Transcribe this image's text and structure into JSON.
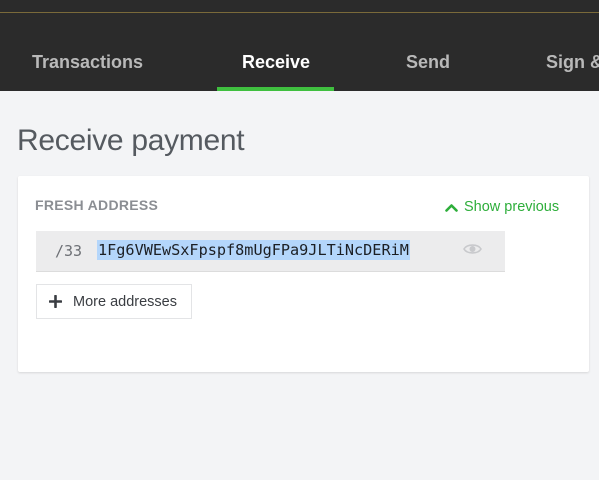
{
  "nav": {
    "tabs": [
      {
        "label": "Transactions",
        "active": false
      },
      {
        "label": "Receive",
        "active": true
      },
      {
        "label": "Send",
        "active": false
      },
      {
        "label": "Sign &",
        "active": false
      }
    ]
  },
  "page": {
    "title": "Receive payment"
  },
  "card": {
    "section_label": "FRESH ADDRESS",
    "show_previous_label": "Show previous",
    "address": {
      "index": "/33",
      "value": "1Fg6VWEwSxFpspf8mUgFPa9JLTiNcDERiM",
      "selected": true
    },
    "more_addresses_label": "More addresses"
  },
  "colors": {
    "accent": "#3fbf3f",
    "link_green": "#2eae3b",
    "topbar": "#2b2b2b",
    "selection": "#b4d6fb"
  },
  "icons": {
    "show_previous": "chevron-up-icon",
    "address_toggle": "eye-icon",
    "more_addresses": "plus-icon"
  }
}
